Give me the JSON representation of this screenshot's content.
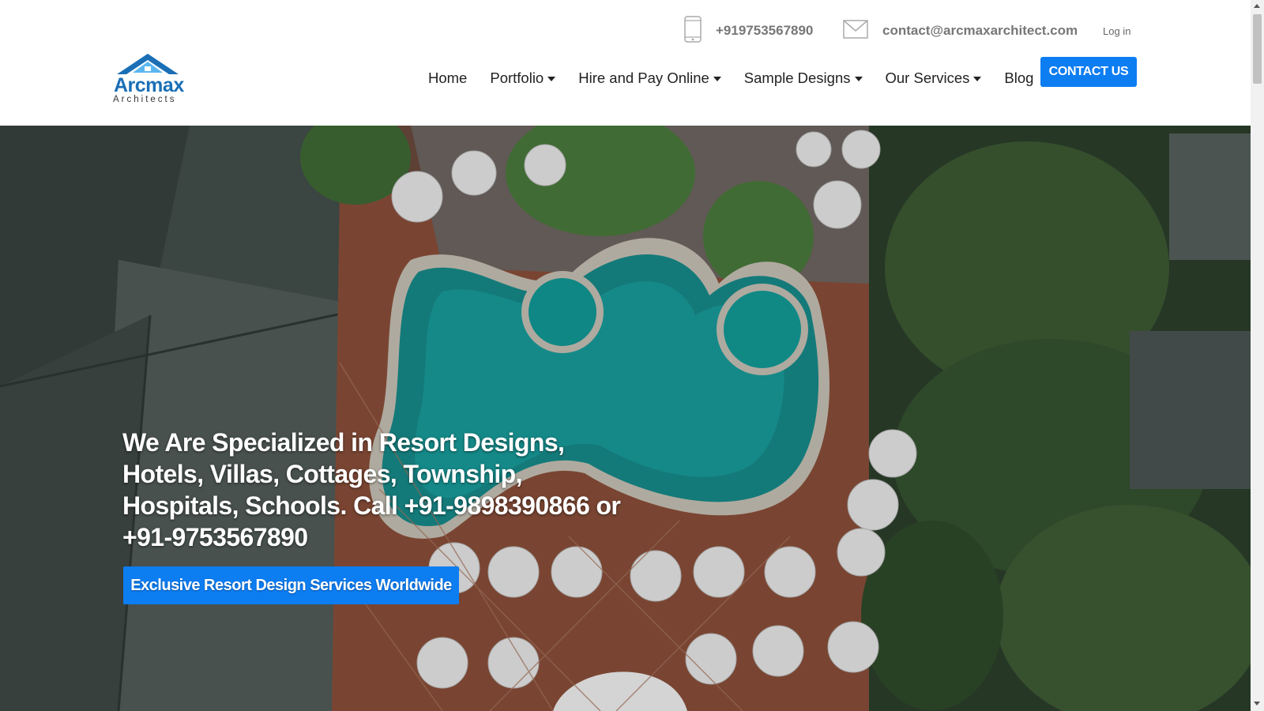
{
  "brand": {
    "name": "Arcmax",
    "subtitle": "Architects"
  },
  "topbar": {
    "phone": "+919753567890",
    "email": "contact@arcmaxarchitect.com",
    "login": "Log in"
  },
  "nav": {
    "items": [
      {
        "label": "Home",
        "dropdown": false
      },
      {
        "label": "Portfolio",
        "dropdown": true
      },
      {
        "label": "Hire and Pay Online",
        "dropdown": true
      },
      {
        "label": "Sample Designs",
        "dropdown": true
      },
      {
        "label": "Our Services",
        "dropdown": true
      },
      {
        "label": "Blog",
        "dropdown": false
      }
    ],
    "contact_button": "CONTACT US"
  },
  "hero": {
    "headline": "We Are Specialized in Resort Designs, Hotels, Villas, Cottages, Township, Hospitals, Schools. Call +91-9898390866 or +91-9753567890",
    "button": "Exclusive Resort Design Services Worldwide"
  },
  "colors": {
    "accent": "#0d7df2",
    "logo": "#1a6fb6"
  }
}
